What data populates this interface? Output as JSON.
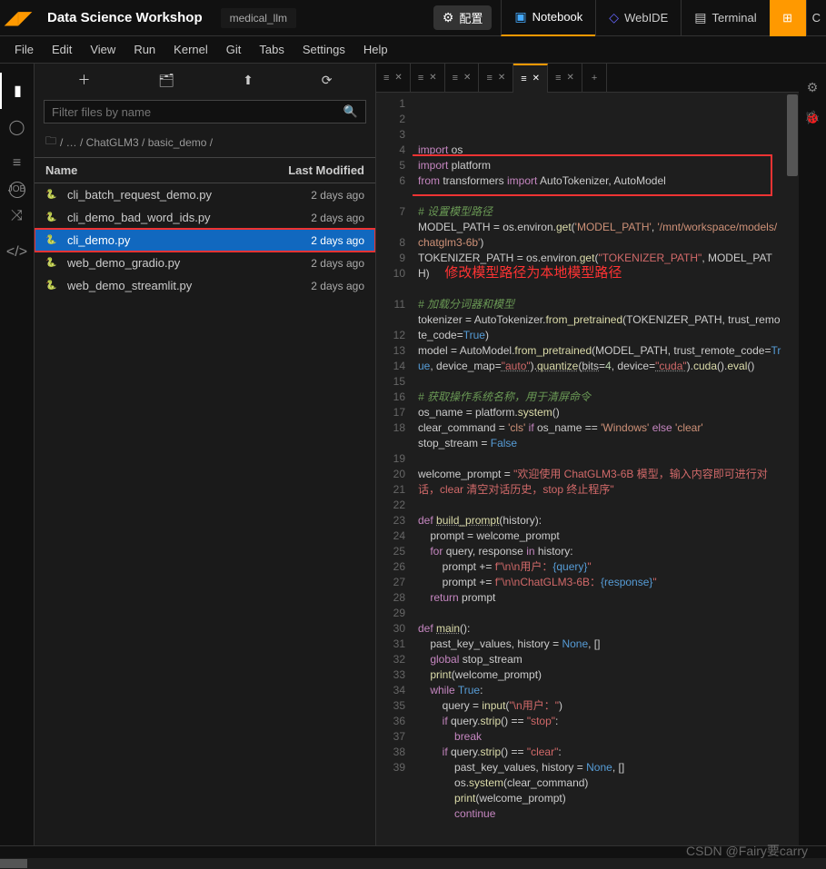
{
  "top": {
    "workspace": "Data Science Workshop",
    "project": "medical_llm",
    "config": "配置",
    "tabs": [
      "Notebook",
      "WebIDE",
      "Terminal"
    ],
    "lastBtn": "C"
  },
  "menu": [
    "File",
    "Edit",
    "View",
    "Run",
    "Kernel",
    "Git",
    "Tabs",
    "Settings",
    "Help"
  ],
  "sidebar": {
    "filterPlaceholder": "Filter files by name",
    "breadcrumb": [
      "",
      "…",
      "ChatGLM3",
      "basic_demo",
      ""
    ],
    "headerName": "Name",
    "headerDate": "Last Modified",
    "files": [
      {
        "name": "cli_batch_request_demo.py",
        "date": "2 days ago"
      },
      {
        "name": "cli_demo_bad_word_ids.py",
        "date": "2 days ago"
      },
      {
        "name": "cli_demo.py",
        "date": "2 days ago",
        "selected": true,
        "boxed": true
      },
      {
        "name": "web_demo_gradio.py",
        "date": "2 days ago"
      },
      {
        "name": "web_demo_streamlit.py",
        "date": "2 days ago"
      }
    ]
  },
  "editorTabs": {
    "count": 6,
    "activeIndex": 4
  },
  "annotation": "修改模型路径为本地模型路径",
  "code": {
    "lines": [
      {
        "n": 1,
        "html": "<span class='kw2'>import</span> os"
      },
      {
        "n": 2,
        "html": "<span class='kw2'>import</span> platform"
      },
      {
        "n": 3,
        "html": "<span class='kw2'>from</span> transformers <span class='kw2'>import</span> AutoTokenizer, AutoModel"
      },
      {
        "n": 4,
        "html": ""
      },
      {
        "n": 5,
        "html": "<span class='com'># 设置模型路径</span>"
      },
      {
        "n": 6,
        "html": "MODEL_PATH <span class='op'>=</span> os.environ.<span class='fn'>get</span>(<span class='str'>'MODEL_PATH'</span>, <span class='str'>'/mnt/workspace/models/chatglm3-6b'</span>)"
      },
      {
        "n": 7,
        "html": "TOKENIZER_PATH <span class='op'>=</span> os.environ.<span class='fn'>get</span>(<span class='str2'>\"TOKENIZER_PATH\"</span>, MODEL_PATH)     <span class='redtext'>修改模型路径为本地模型路径</span>"
      },
      {
        "n": 8,
        "html": ""
      },
      {
        "n": 9,
        "html": "<span class='com'># 加载分词器和模型</span>"
      },
      {
        "n": 10,
        "html": "tokenizer <span class='op'>=</span> AutoTokenizer.<span class='fn'>from_pretrained</span>(TOKENIZER_PATH, trust_remote_code<span class='op'>=</span><span class='const'>True</span>)"
      },
      {
        "n": 11,
        "html": "model <span class='op'>=</span> AutoModel.<span class='fn'>from_pretrained</span>(MODEL_PATH, trust_remote_code<span class='op'>=</span><span class='const'>True</span>, device_map<span class='op'>=</span><span class='str2 und'>\"auto\"</span>).<span class='fn und'>quantize</span>(<span class='und'>bits</span><span class='op'>=</span><span class='num'>4</span>, device<span class='op'>=</span><span class='str2 und'>\"cuda\"</span>).<span class='fn'>cuda</span>().<span class='fn'>eval</span>()"
      },
      {
        "n": 12,
        "html": ""
      },
      {
        "n": 13,
        "html": "<span class='com'># 获取操作系统名称，用于清屏命令</span>"
      },
      {
        "n": 14,
        "html": "os_name <span class='op'>=</span> platform.<span class='fn'>system</span>()"
      },
      {
        "n": 15,
        "html": "clear_command <span class='op'>=</span> <span class='str'>'cls'</span> <span class='kw2'>if</span> os_name <span class='op'>==</span> <span class='str'>'Windows'</span> <span class='kw2'>else</span> <span class='str'>'clear'</span>"
      },
      {
        "n": 16,
        "html": "stop_stream <span class='op'>=</span> <span class='const'>False</span>"
      },
      {
        "n": 17,
        "html": ""
      },
      {
        "n": 18,
        "html": "welcome_prompt <span class='op'>=</span> <span class='str2'>\"欢迎使用 ChatGLM3-6B 模型，输入内容即可进行对话，clear 清空对话历史，stop 终止程序\"</span>"
      },
      {
        "n": 19,
        "html": ""
      },
      {
        "n": 20,
        "html": "<span class='kw2'>def</span> <span class='fn und'>build_prompt</span>(history):"
      },
      {
        "n": 21,
        "html": "    prompt <span class='op'>=</span> welcome_prompt"
      },
      {
        "n": 22,
        "html": "    <span class='kw2'>for</span> query, response <span class='kw2'>in</span> history:"
      },
      {
        "n": 23,
        "html": "        prompt <span class='op'>+=</span> <span class='str2'>f\"\\n\\n用户：</span><span class='const'>{query}</span><span class='str2'>\"</span>"
      },
      {
        "n": 24,
        "html": "        prompt <span class='op'>+=</span> <span class='str2'>f\"\\n\\nChatGLM3-6B：</span><span class='const'>{response}</span><span class='str2'>\"</span>"
      },
      {
        "n": 25,
        "html": "    <span class='kw2'>return</span> prompt"
      },
      {
        "n": 26,
        "html": ""
      },
      {
        "n": 27,
        "html": "<span class='kw2'>def</span> <span class='fn und'>main</span>():"
      },
      {
        "n": 28,
        "html": "    past_key_values, history <span class='op'>=</span> <span class='const'>None</span>, []"
      },
      {
        "n": 29,
        "html": "    <span class='kw2'>global</span> stop_stream"
      },
      {
        "n": 30,
        "html": "    <span class='fn'>print</span>(welcome_prompt)"
      },
      {
        "n": 31,
        "html": "    <span class='kw2'>while</span> <span class='const'>True</span>:"
      },
      {
        "n": 32,
        "html": "        query <span class='op'>=</span> <span class='fn'>input</span>(<span class='str2'>\"\\n用户：\"</span>)"
      },
      {
        "n": 33,
        "html": "        <span class='kw2'>if</span> query.<span class='fn'>strip</span>() <span class='op'>==</span> <span class='str2'>\"stop\"</span>:"
      },
      {
        "n": 34,
        "html": "            <span class='kw2'>break</span>"
      },
      {
        "n": 35,
        "html": "        <span class='kw2'>if</span> query.<span class='fn'>strip</span>() <span class='op'>==</span> <span class='str2'>\"clear\"</span>:"
      },
      {
        "n": 36,
        "html": "            past_key_values, history <span class='op'>=</span> <span class='const'>None</span>, []"
      },
      {
        "n": 37,
        "html": "            os.<span class='fn'>system</span>(clear_command)"
      },
      {
        "n": 38,
        "html": "            <span class='fn'>print</span>(welcome_prompt)"
      },
      {
        "n": 39,
        "html": "            <span class='kw2'>continue</span>"
      }
    ]
  },
  "watermark": "CSDN @Fairy要carry"
}
